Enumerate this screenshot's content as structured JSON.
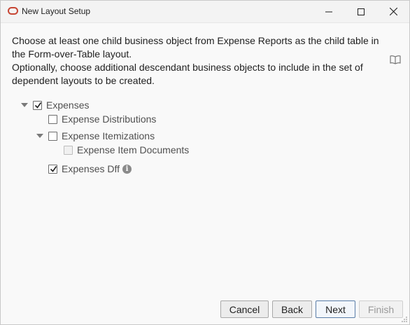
{
  "window": {
    "title": "New Layout Setup",
    "accent_color": "#c74634"
  },
  "instructions": {
    "line1": "Choose at least one child business object from Expense Reports as the child table in the Form-over-Table layout.",
    "line2": "Optionally, choose additional descendant business objects to include in the set of dependent layouts to be created."
  },
  "tree": {
    "items": [
      {
        "label": "Expenses",
        "checked": true,
        "expanded": true
      },
      {
        "label": "Expense Distributions",
        "checked": false
      },
      {
        "label": "Expense Itemizations",
        "checked": false,
        "expanded": true
      },
      {
        "label": "Expense Item Documents",
        "checked": false,
        "disabled": true
      },
      {
        "label": "Expenses Dff",
        "checked": true,
        "has_info": true
      }
    ]
  },
  "buttons": {
    "cancel": "Cancel",
    "back": "Back",
    "next": "Next",
    "finish": "Finish"
  }
}
